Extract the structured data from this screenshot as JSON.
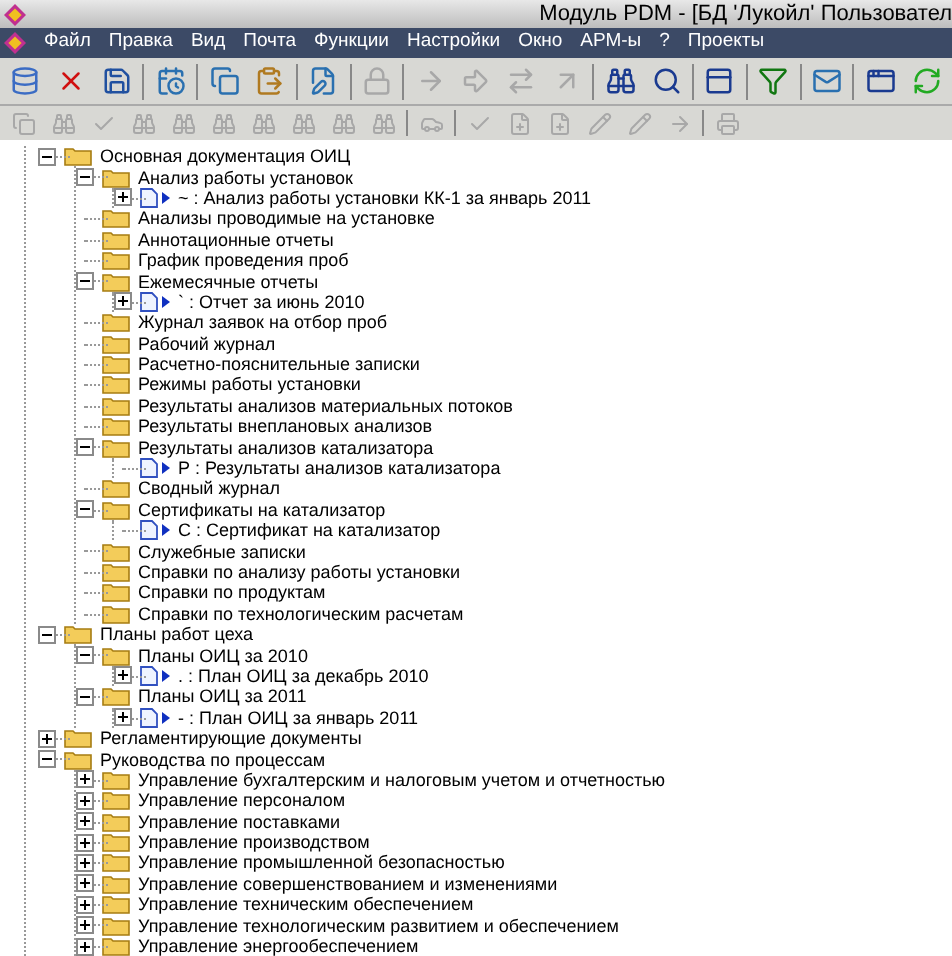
{
  "window": {
    "title": "Модуль PDM - [БД 'Лукойл' Пользовател"
  },
  "menu": [
    "Файл",
    "Правка",
    "Вид",
    "Почта",
    "Функции",
    "Настройки",
    "Окно",
    "АРМ-ы",
    "?",
    "Проекты"
  ],
  "toolbar": [
    {
      "disabled": false
    },
    {
      "disabled": false
    },
    {
      "disabled": false
    },
    {
      "disabled": false
    },
    {
      "disabled": false
    },
    {
      "disabled": false
    },
    {
      "disabled": false
    },
    {
      "disabled": true
    },
    {
      "disabled": true
    },
    {
      "disabled": true
    },
    {
      "disabled": true
    },
    {
      "disabled": true
    },
    {
      "disabled": false
    },
    {
      "disabled": false
    },
    {
      "disabled": false
    },
    {
      "disabled": false
    },
    {
      "disabled": false
    },
    {
      "disabled": false
    },
    {
      "disabled": false
    }
  ],
  "toolbar_2": [
    {
      "disabled": true
    },
    {
      "disabled": true
    },
    {
      "disabled": true
    },
    {
      "disabled": true
    },
    {
      "disabled": true
    },
    {
      "disabled": true
    },
    {
      "disabled": true
    },
    {
      "disabled": true
    },
    {
      "disabled": true
    },
    {
      "disabled": true
    },
    {
      "disabled": true
    },
    {
      "disabled": true
    },
    {
      "disabled": true
    },
    {
      "disabled": true
    },
    {
      "disabled": true
    },
    {
      "disabled": true
    },
    {
      "disabled": true
    },
    {
      "disabled": true
    }
  ],
  "tree": [
    {
      "label": "Основная документация ОИЦ",
      "kind": "folder",
      "expanded": true,
      "children": [
        {
          "label": "Анализ работы установок",
          "kind": "folder",
          "expanded": true,
          "children": [
            {
              "label": "~ : Анализ работы установки КК-1 за январь 2011",
              "kind": "document",
              "expanded": false
            }
          ]
        },
        {
          "label": "Анализы проводимые на установке",
          "kind": "folder"
        },
        {
          "label": "Аннотационные отчеты",
          "kind": "folder"
        },
        {
          "label": "График проведения проб",
          "kind": "folder"
        },
        {
          "label": "Ежемесячные отчеты",
          "kind": "folder",
          "expanded": true,
          "children": [
            {
              "label": "` : Отчет за июнь 2010",
              "kind": "document",
              "expanded": false
            }
          ]
        },
        {
          "label": "Журнал заявок на отбор проб",
          "kind": "folder"
        },
        {
          "label": "Рабочий журнал",
          "kind": "folder"
        },
        {
          "label": "Расчетно-пояснительные записки",
          "kind": "folder"
        },
        {
          "label": "Режимы работы установки",
          "kind": "folder"
        },
        {
          "label": "Результаты анализов материальных потоков",
          "kind": "folder"
        },
        {
          "label": "Результаты внеплановых анализов",
          "kind": "folder"
        },
        {
          "label": "Результаты анализов катализатора",
          "kind": "folder",
          "expanded": true,
          "children": [
            {
              "label": "Р : Результаты анализов катализатора",
              "kind": "document"
            }
          ]
        },
        {
          "label": "Сводный журнал",
          "kind": "folder"
        },
        {
          "label": "Сертификаты на катализатор",
          "kind": "folder",
          "expanded": true,
          "children": [
            {
              "label": "С : Сертификат на катализатор",
              "kind": "document"
            }
          ]
        },
        {
          "label": "Служебные записки",
          "kind": "folder"
        },
        {
          "label": "Справки по анализу работы установки",
          "kind": "folder"
        },
        {
          "label": "Справки по продуктам",
          "kind": "folder"
        },
        {
          "label": "Справки по технологическим расчетам",
          "kind": "folder"
        }
      ]
    },
    {
      "label": "Планы работ цеха",
      "kind": "folder",
      "expanded": true,
      "children": [
        {
          "label": "Планы ОИЦ за 2010",
          "kind": "folder",
          "expanded": true,
          "children": [
            {
              "label": ". : План ОИЦ за декабрь 2010",
              "kind": "document",
              "expanded": false
            }
          ]
        },
        {
          "label": "Планы ОИЦ за 2011",
          "kind": "folder",
          "expanded": true,
          "children": [
            {
              "label": "- : План ОИЦ за январь 2011",
              "kind": "document",
              "expanded": false
            }
          ]
        }
      ]
    },
    {
      "label": "Регламентирующие документы",
      "kind": "folder",
      "expanded": false
    },
    {
      "label": "Руководства по процессам",
      "kind": "folder",
      "expanded": true,
      "children": [
        {
          "label": "Управление бухгалтерским и налоговым учетом и отчетностью",
          "kind": "folder",
          "expanded": false
        },
        {
          "label": "Управление персоналом",
          "kind": "folder",
          "expanded": false
        },
        {
          "label": "Управление поставками",
          "kind": "folder",
          "expanded": false
        },
        {
          "label": "Управление производством",
          "kind": "folder",
          "expanded": false
        },
        {
          "label": "Управление промышленной безопасностью",
          "kind": "folder",
          "expanded": false
        },
        {
          "label": "Управление совершенствованием и изменениями",
          "kind": "folder",
          "expanded": false
        },
        {
          "label": "Управление техническим обеспечением",
          "kind": "folder",
          "expanded": false
        },
        {
          "label": "Управление технологическим развитием и обеспечением",
          "kind": "folder",
          "expanded": false
        },
        {
          "label": "Управление энергообеспечением",
          "kind": "folder",
          "expanded": false
        }
      ]
    }
  ]
}
